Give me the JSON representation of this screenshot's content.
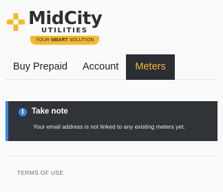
{
  "logo": {
    "brand": "MidCity",
    "sub": "UTILITIES",
    "tagline_pre": "YOUR ",
    "tagline_bold": "SMART",
    "tagline_post": " SOLUTION",
    "icon": "plus-icon",
    "colors": {
      "accent": "#f6b92b",
      "text": "#2d2f31"
    }
  },
  "tabs": [
    {
      "label": "Buy Prepaid",
      "active": false
    },
    {
      "label": "Account",
      "active": false
    },
    {
      "label": "Meters",
      "active": true
    }
  ],
  "alert": {
    "icon": "info-icon",
    "title": "Take note",
    "message": "Your email address is not linked to any existing meters yet.",
    "colors": {
      "background": "#303337",
      "border": "#3a86e8"
    }
  },
  "footer": {
    "terms_label": "TERMS OF USE"
  }
}
